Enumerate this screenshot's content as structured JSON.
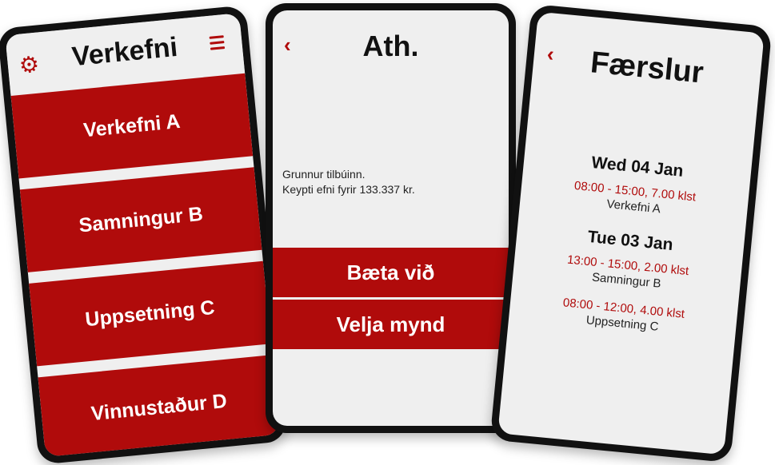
{
  "phone1": {
    "title": "Verkefni",
    "items": [
      {
        "label": "Verkefni A"
      },
      {
        "label": "Samningur B"
      },
      {
        "label": "Uppsetning C"
      },
      {
        "label": "Vinnustaður D"
      }
    ]
  },
  "phone2": {
    "title": "Ath.",
    "note_line1": "Grunnur tilbúinn.",
    "note_line2": "Keypti efni fyrir 133.337 kr.",
    "btn_add": "Bæta við",
    "btn_image": "Velja mynd"
  },
  "phone3": {
    "title": "Færslur",
    "days": [
      {
        "date": "Wed 04 Jan",
        "entries": [
          {
            "time": "08:00 - 15:00, 7.00 klst",
            "task": "Verkefni A"
          }
        ]
      },
      {
        "date": "Tue 03 Jan",
        "entries": [
          {
            "time": "13:00 - 15:00, 2.00 klst",
            "task": "Samningur B"
          },
          {
            "time": "08:00 - 12:00, 4.00 klst",
            "task": "Uppsetning C"
          }
        ]
      }
    ]
  },
  "colors": {
    "accent": "#b00b0b",
    "screen_bg": "#efefef",
    "frame": "#111111"
  }
}
